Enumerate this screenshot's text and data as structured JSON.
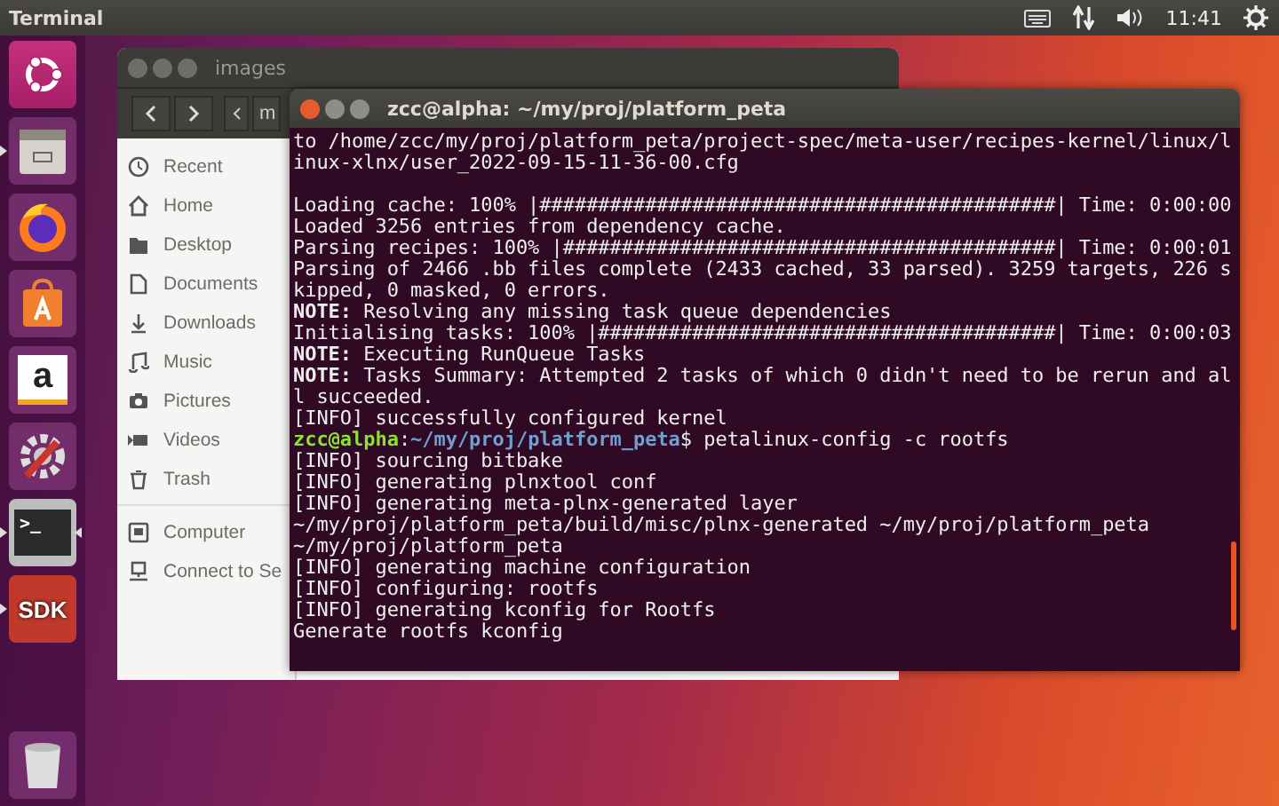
{
  "top_panel": {
    "title": "Terminal",
    "clock": "11:41"
  },
  "launcher": [
    {
      "running": false,
      "focused": false
    },
    {
      "running": true,
      "focused": false
    },
    {
      "running": false,
      "focused": false
    },
    {
      "running": false,
      "focused": false
    },
    {
      "running": false,
      "focused": false,
      "glyph": "a"
    },
    {
      "running": false,
      "focused": false
    },
    {
      "running": true,
      "focused": true,
      "glyph": ">_"
    },
    {
      "running": true,
      "focused": false,
      "glyph": "SDK"
    },
    {
      "running": false,
      "focused": false
    }
  ],
  "files_window": {
    "title": "images",
    "path_buttons": [
      "m"
    ],
    "sidebar": {
      "places": [
        "Recent",
        "Home",
        "Desktop",
        "Documents",
        "Downloads",
        "Music",
        "Pictures",
        "Videos",
        "Trash"
      ],
      "devices": [
        "Computer",
        "Connect to Se"
      ]
    }
  },
  "terminal_window": {
    "title": "zcc@alpha: ~/my/proj/platform_peta",
    "lines": [
      {
        "kind": "plain",
        "text": "to /home/zcc/my/proj/platform_peta/project-spec/meta-user/recipes-kernel/linux/l"
      },
      {
        "kind": "plain",
        "text": "inux-xlnx/user_2022-09-15-11-36-00.cfg"
      },
      {
        "kind": "blank"
      },
      {
        "kind": "plain",
        "text": "Loading cache: 100% |############################################| Time: 0:00:00"
      },
      {
        "kind": "plain",
        "text": "Loaded 3256 entries from dependency cache."
      },
      {
        "kind": "plain",
        "text": "Parsing recipes: 100% |##########################################| Time: 0:00:01"
      },
      {
        "kind": "plain",
        "text": "Parsing of 2466 .bb files complete (2433 cached, 33 parsed). 3259 targets, 226 s"
      },
      {
        "kind": "plain",
        "text": "kipped, 0 masked, 0 errors."
      },
      {
        "kind": "note",
        "text": "**NOTE:** Resolving any missing task queue dependencies"
      },
      {
        "kind": "plain",
        "text": "Initialising tasks: 100% |#######################################| Time: 0:00:03"
      },
      {
        "kind": "note",
        "text": "**NOTE:** Executing RunQueue Tasks"
      },
      {
        "kind": "note",
        "text": "**NOTE:** Tasks Summary: Attempted 2 tasks of which 0 didn't need to be rerun and al"
      },
      {
        "kind": "plain",
        "text": "l succeeded."
      },
      {
        "kind": "plain",
        "text": "[INFO] successfully configured kernel"
      },
      {
        "kind": "prompt",
        "user": "zcc@alpha",
        "separator": ":",
        "path": "~/my/proj/platform_peta",
        "command": "$ petalinux-config -c rootfs"
      },
      {
        "kind": "plain",
        "text": "[INFO] sourcing bitbake"
      },
      {
        "kind": "plain",
        "text": "[INFO] generating plnxtool conf"
      },
      {
        "kind": "plain",
        "text": "[INFO] generating meta-plnx-generated layer"
      },
      {
        "kind": "plain",
        "text": "~/my/proj/platform_peta/build/misc/plnx-generated ~/my/proj/platform_peta"
      },
      {
        "kind": "plain",
        "text": "~/my/proj/platform_peta"
      },
      {
        "kind": "plain",
        "text": "[INFO] generating machine configuration"
      },
      {
        "kind": "plain",
        "text": "[INFO] configuring: rootfs"
      },
      {
        "kind": "plain",
        "text": "[INFO] generating kconfig for Rootfs"
      },
      {
        "kind": "plain",
        "text": "Generate rootfs kconfig"
      }
    ]
  }
}
